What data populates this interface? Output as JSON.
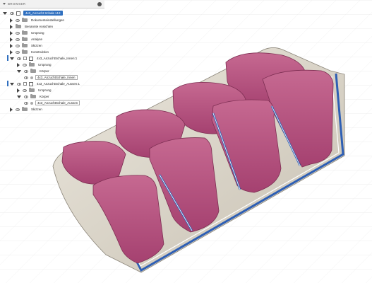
{
  "browser": {
    "title": "BROWSER",
    "root_label": "4x3_Anzucht Schale v13",
    "items": [
      {
        "label": "Dokumenteinstellungen"
      },
      {
        "label": "Benannte Ansichten"
      },
      {
        "label": "Ursprung"
      },
      {
        "label": "Analyse"
      },
      {
        "label": "Skizzen"
      },
      {
        "label": "Konstruktion"
      },
      {
        "label": "4x3_AnzuchtSchale_Innen:1"
      },
      {
        "label": "Ursprung"
      },
      {
        "label": "Körper"
      },
      {
        "label": "4x3_AnzuchtSchale_Innen"
      },
      {
        "label": "4x3_AnzuchtSchale_Aussen:1"
      },
      {
        "label": "Ursprung"
      },
      {
        "label": "Körper"
      },
      {
        "label": "4x3_AnzuchtSchale_Aussen"
      },
      {
        "label": "Skizzen"
      }
    ]
  },
  "colors": {
    "pot_fill": "#b8537e",
    "pot_rim": "#a9406b",
    "shell_outer": "#d8d3c8",
    "shell_wall": "#c9c3b6",
    "section_blue": "#2e5fb4",
    "grid_line": "#dcdcdc",
    "selection": "#2f6fbf"
  }
}
